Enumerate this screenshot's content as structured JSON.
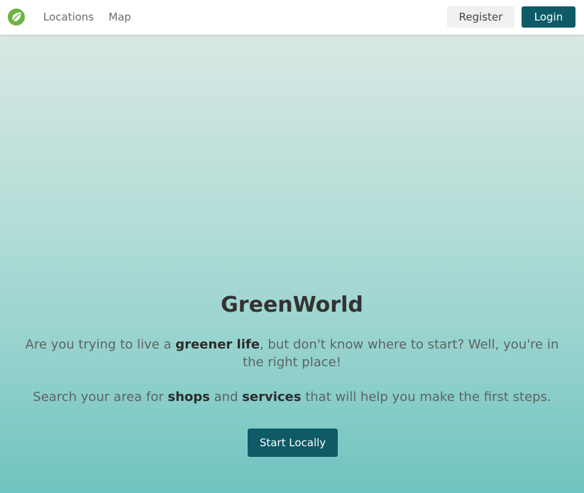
{
  "nav": {
    "logo_icon": "leaf-icon",
    "links": [
      "Locations",
      "Map"
    ],
    "register_label": "Register",
    "login_label": "Login"
  },
  "hero": {
    "title": "GreenWorld",
    "p1": {
      "before": "Are you trying to live a ",
      "bold": "greener life",
      "after": ", but don't know where to start? Well, you're in the right place!"
    },
    "p2": {
      "before": "Search your area for ",
      "bold1": "shops",
      "middle": " and ",
      "bold2": "services",
      "after": " that will help you make the first steps."
    },
    "cta_label": "Start Locally"
  },
  "colors": {
    "primary": "#0e5a66",
    "logo_green": "#6db33f",
    "gradient_top": "#d9e8e4",
    "gradient_bottom": "#6fc3c0"
  }
}
